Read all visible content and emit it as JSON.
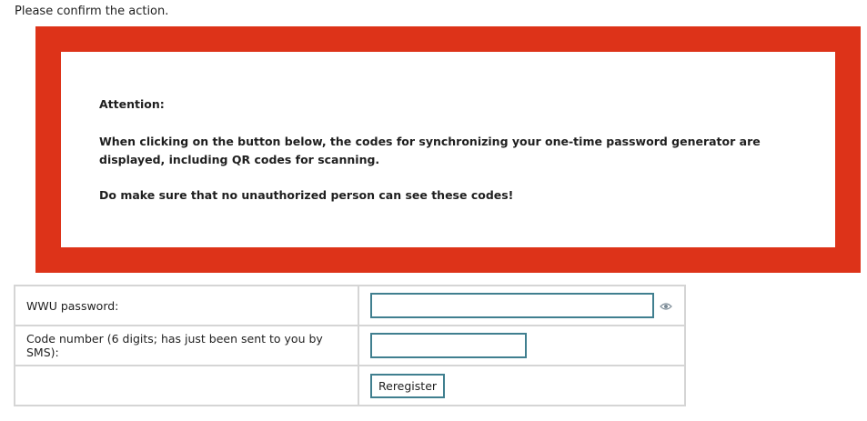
{
  "prompt": "Please confirm the action.",
  "alert": {
    "heading": "Attention:",
    "body1": "When clicking on the button below, the codes for synchronizing your one-time password generator are displayed, including QR codes for scanning.",
    "body2": "Do make sure that no unauthorized person can see these codes!",
    "frame_color": "#dd3319"
  },
  "form": {
    "password_label": "WWU password:",
    "password_value": "",
    "password_icon": "eye-icon",
    "code_label": "Code number (6 digits; has just been sent to you by SMS):",
    "code_value": "",
    "submit_label": "Reregister",
    "accent_color": "#407f8f"
  }
}
